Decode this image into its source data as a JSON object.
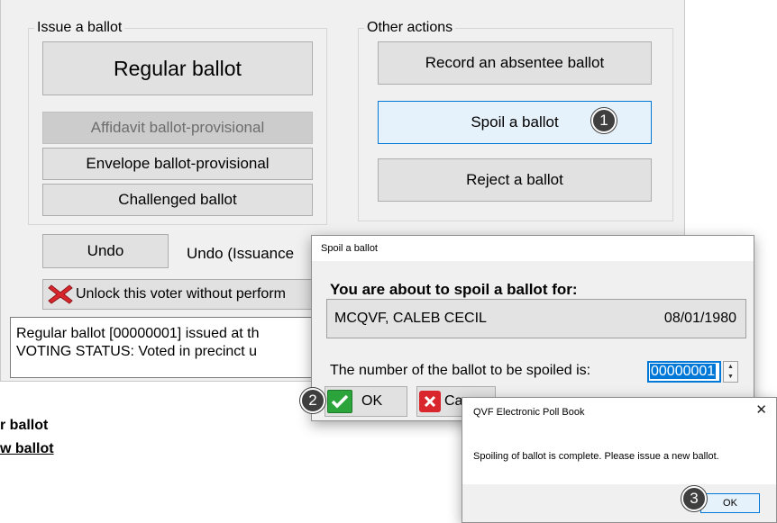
{
  "issue": {
    "legend": "Issue a ballot",
    "regular": "Regular ballot",
    "affidavit": "Affidavit ballot-provisional",
    "envelope": "Envelope ballot-provisional",
    "challenged": "Challenged ballot"
  },
  "other": {
    "legend": "Other actions",
    "absentee": "Record an absentee ballot",
    "spoil": "Spoil a ballot",
    "reject": "Reject a ballot"
  },
  "undo": {
    "button": "Undo",
    "label": "Undo (Issuance"
  },
  "unlock": {
    "label": "Unlock this voter without perform"
  },
  "status": {
    "line1": "Regular ballot [00000001] issued at th",
    "line2": "VOTING STATUS: Voted in precinct u"
  },
  "background_text": {
    "line1": "r ballot",
    "line2": "w ballot"
  },
  "spoil_dialog": {
    "title": "Spoil a ballot",
    "heading": "You are about to spoil a ballot for:",
    "voter_name": "MCQVF, CALEB CECIL",
    "voter_dob": "08/01/1980",
    "number_label": "The number of the ballot to be spoiled is:",
    "ballot_number": "00000001",
    "ok": "OK",
    "cancel": "Ca"
  },
  "message_box": {
    "title": "QVF Electronic Poll Book",
    "close": "✕",
    "text": "Spoiling of ballot is complete. Please issue a new ballot.",
    "ok": "OK"
  },
  "callouts": {
    "one": "1",
    "two": "2",
    "three": "3"
  },
  "icons": {
    "unlock": "red-x-icon",
    "ok": "green-check-icon",
    "cancel": "red-x-icon"
  },
  "colors": {
    "focus_blue": "#0078d7",
    "check_green": "#2aa43b",
    "cancel_red": "#d9262c"
  }
}
